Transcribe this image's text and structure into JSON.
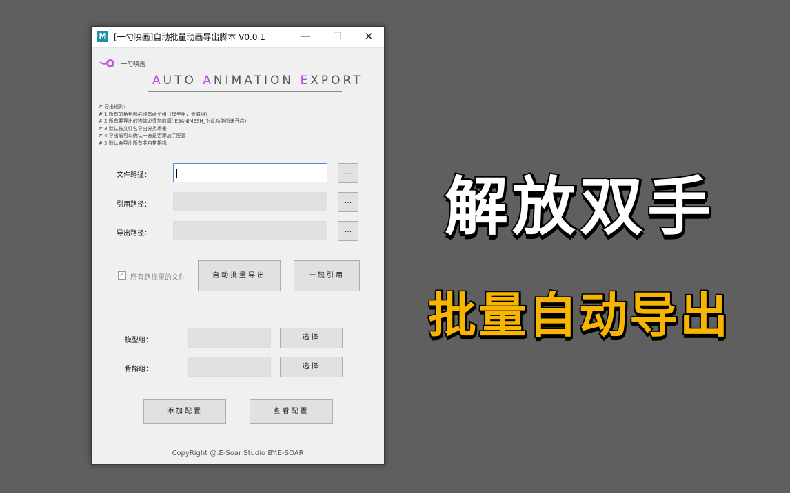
{
  "window": {
    "title": "[一勺映画]自动批量动画导出脚本    V0.0.1",
    "icon_letter": "M",
    "controls": {
      "minimize": "—",
      "maximize": "☐",
      "close": "✕"
    }
  },
  "logo": {
    "text": "一勺映画"
  },
  "banner": {
    "parts": [
      "A",
      "UTO ",
      "A",
      "NIMATION ",
      "E",
      "XPORT"
    ]
  },
  "rules": [
    "# 导出规则:",
    "# 1.所有的角色都必须有两个组（模型组，骨骼组）",
    "# 2.所有要导出的物体必须加前缀('ESANIMESH_')(此功能尚未开启)",
    "# 3.默认按文件名导出分类场景",
    "# 4.导出前可以确认一遍是否添加了配置",
    "# 5.默认会导出所有非自带相机"
  ],
  "paths": {
    "file_label": "文件路径：",
    "ref_label": "引用路径：",
    "export_label": "导出路径：",
    "file_value": "",
    "ref_value": "",
    "export_value": "",
    "browse_label": "..."
  },
  "options": {
    "all_files_label": "所有路径里的文件",
    "all_files_checked": true
  },
  "buttons": {
    "auto_export": "自动批量导出",
    "one_click_ref": "一键引用",
    "select": "选择",
    "add_config": "添加配置",
    "view_config": "查看配置"
  },
  "groups": {
    "model_label": "模型组：",
    "bone_label": "骨骼组：",
    "model_value": "",
    "bone_value": ""
  },
  "footer": {
    "copyright": "CopyRight @.E-Soar Studio BY:E-SOAR"
  },
  "overlay": {
    "headline": "解放双手",
    "subhead": "批量自动导出"
  },
  "colors": {
    "background": "#5f5f5f",
    "banner_accent": "#b44cd8",
    "subhead": "#f7b400",
    "headline": "#ffffff"
  }
}
